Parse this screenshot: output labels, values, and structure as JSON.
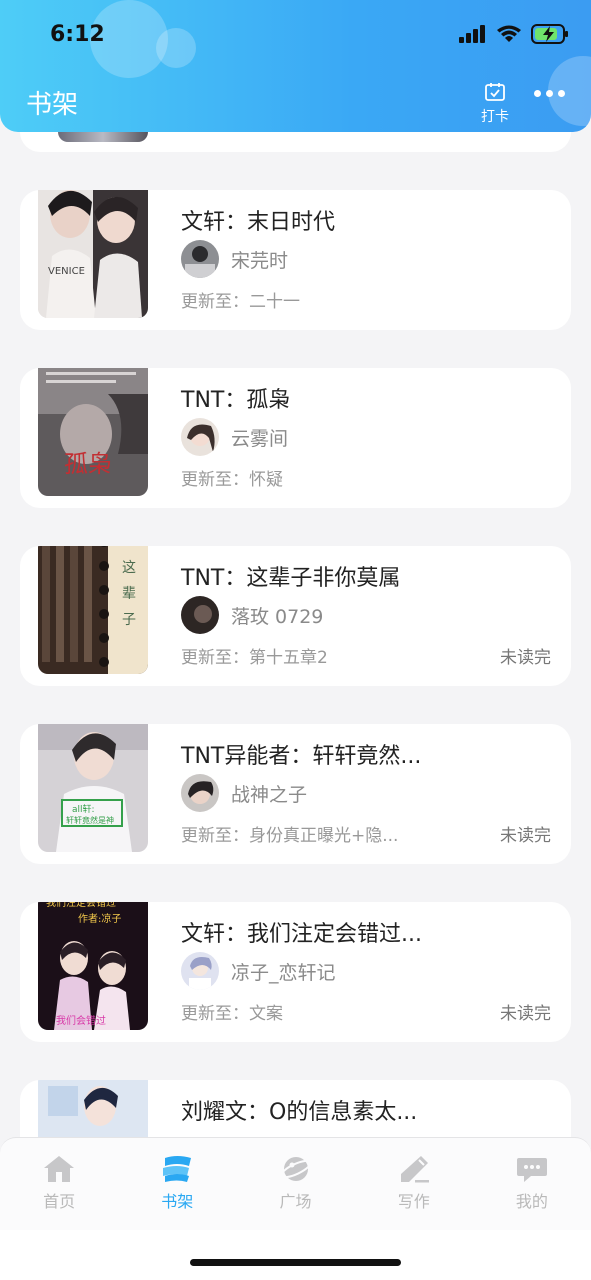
{
  "status_bar": {
    "time": "6:12"
  },
  "header": {
    "title": "书架",
    "checkin_label": "打卡"
  },
  "books": [
    {
      "title": "文轩：末日时代",
      "author": "宋芫时",
      "update": "更新至：二十一",
      "unread": ""
    },
    {
      "title": "TNT：孤枭",
      "author": "云雾间",
      "update": "更新至：怀疑",
      "unread": ""
    },
    {
      "title": "TNT：这辈子非你莫属",
      "author": "落玫 0729",
      "update": "更新至：第十五章2",
      "unread": "未读完"
    },
    {
      "title": "TNT异能者：轩轩竟然...",
      "author": "战神之子",
      "update": "更新至：身份真正曝光+隐...",
      "unread": "未读完"
    },
    {
      "title": "文轩：我们注定会错过...",
      "author": "凉子_恋轩记",
      "update": "更新至：文案",
      "unread": "未读完"
    },
    {
      "title": "刘耀文：O的信息素太...",
      "author": "",
      "update": "",
      "unread": ""
    }
  ],
  "tabs": [
    {
      "label": "首页",
      "icon": "home-icon"
    },
    {
      "label": "书架",
      "icon": "bookshelf-icon"
    },
    {
      "label": "广场",
      "icon": "planet-icon"
    },
    {
      "label": "写作",
      "icon": "pen-icon"
    },
    {
      "label": "我的",
      "icon": "chat-bubble-icon"
    }
  ],
  "active_tab": "书架",
  "colors": {
    "accent": "#2aa8f2",
    "header_start": "#4ecdf7",
    "header_end": "#3b9cf2"
  }
}
